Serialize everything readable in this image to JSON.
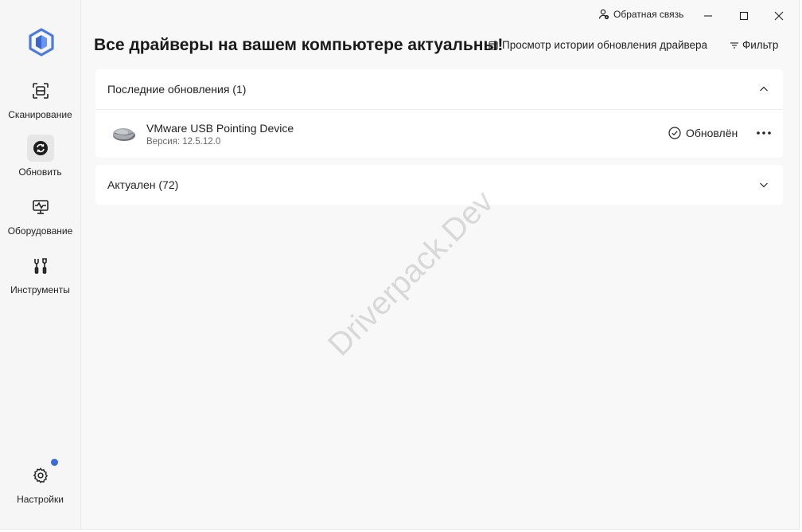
{
  "titlebar": {
    "feedback_label": "Обратная связь"
  },
  "sidebar": {
    "items": [
      {
        "label": "Сканирование",
        "icon": "scan-icon",
        "active": false
      },
      {
        "label": "Обновить",
        "icon": "refresh-icon",
        "active": true
      },
      {
        "label": "Оборудование",
        "icon": "monitor-icon",
        "active": false
      },
      {
        "label": "Инструменты",
        "icon": "tools-icon",
        "active": false
      }
    ],
    "settings_label": "Настройки",
    "settings_icon": "gear-icon"
  },
  "header": {
    "title": "Все драйверы на вашем компьютере актуальны!",
    "history_label": "Просмотр истории обновления драйвера",
    "filter_label": "Фильтр"
  },
  "recent": {
    "header": "Последние обновления (1)",
    "expanded": true,
    "devices": [
      {
        "name": "VMware USB Pointing Device",
        "version": "Версия: 12.5.12.0",
        "status": "Обновлён",
        "icon": "mouse-icon"
      }
    ]
  },
  "uptodate": {
    "header": "Актуален (72)",
    "expanded": false
  },
  "watermark": "Driverpack.Dev",
  "colors": {
    "accent": "#3d6bd6",
    "logo": "#4b7be0"
  }
}
